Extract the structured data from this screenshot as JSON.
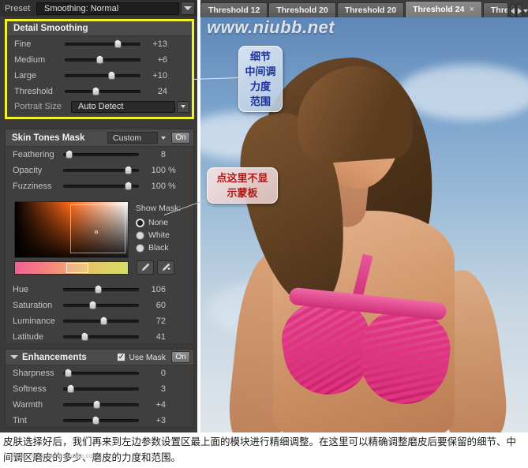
{
  "preset": {
    "label": "Preset",
    "value": "Smoothing: Normal",
    "dropdown_icon": "chevron-down-icon"
  },
  "detail_smoothing": {
    "title": "Detail Smoothing",
    "sliders": [
      {
        "name": "Fine",
        "value": "+13",
        "pos": 72
      },
      {
        "name": "Medium",
        "value": "+6",
        "pos": 46
      },
      {
        "name": "Large",
        "value": "+10",
        "pos": 63
      },
      {
        "name": "Threshold",
        "value": "24",
        "pos": 40
      }
    ],
    "portrait_size": {
      "label": "Portrait Size",
      "value": "Auto Detect"
    }
  },
  "skin_tones_mask": {
    "title": "Skin Tones Mask",
    "preset": "Custom",
    "toggle": "On",
    "sliders": [
      {
        "name": "Feathering",
        "value": "8",
        "unit": "",
        "pos": 4
      },
      {
        "name": "Opacity",
        "value": "100",
        "unit": "%",
        "pos": 90
      },
      {
        "name": "Fuzziness",
        "value": "100",
        "unit": "%",
        "pos": 90
      }
    ],
    "show_mask": {
      "label": "Show Mask:",
      "options": [
        "None",
        "White",
        "Black"
      ],
      "selected": "None"
    },
    "tools": [
      "eyedropper-icon",
      "eyedropper-plus-icon"
    ],
    "color_sliders": [
      {
        "name": "Hue",
        "value": "106",
        "pos": 46
      },
      {
        "name": "Saturation",
        "value": "60",
        "pos": 38
      },
      {
        "name": "Luminance",
        "value": "72",
        "pos": 54
      },
      {
        "name": "Latitude",
        "value": "41",
        "pos": 26
      }
    ]
  },
  "enhancements": {
    "title": "Enhancements",
    "use_mask_label": "Use Mask",
    "use_mask_checked": true,
    "toggle": "On",
    "sliders": [
      {
        "name": "Sharpness",
        "value": "0",
        "pos": 2
      },
      {
        "name": "Softness",
        "value": "3",
        "pos": 6
      },
      {
        "name": "Warmth",
        "value": "+4",
        "pos": 44
      },
      {
        "name": "Tint",
        "value": "+3",
        "pos": 42
      }
    ]
  },
  "tabs": {
    "items": [
      {
        "label": "Threshold 12",
        "active": false,
        "closable": false
      },
      {
        "label": "Threshold 20",
        "active": false,
        "closable": false
      },
      {
        "label": "Threshold 20",
        "active": false,
        "closable": false
      },
      {
        "label": "Threshold 24",
        "active": true,
        "closable": true,
        "close_label": "×"
      },
      {
        "label": "Threshold",
        "active": false,
        "closable": false,
        "clipped": true
      }
    ],
    "nav": {
      "prev_icon": "chevron-left-icon",
      "next_icon": "chevron-right-icon",
      "menu_icon": "chevron-down-icon"
    }
  },
  "photo": {
    "watermark": "www.niubb.net"
  },
  "callouts": [
    {
      "id": "callout-1",
      "lines": [
        "细节",
        "中间调",
        "力度",
        "范围"
      ]
    },
    {
      "id": "callout-2",
      "lines": [
        "点这里不显",
        "示蒙板"
      ]
    }
  ],
  "caption": {
    "text": "皮肤选择好后，我们再来到左边参数设置区最上面的模块进行精细调整。在这里可以精确调整磨皮后要保留的细节、中间调区磨皮的多少、磨皮的力度和范围。",
    "watermark": "思缘论坛  www.missyuan.com"
  },
  "colors": {
    "highlight_border": "#f2f22a",
    "panel_bg": "#3f3f3f",
    "callout_blue_text": "#1d2fa0",
    "callout_red_text": "#b01818"
  }
}
